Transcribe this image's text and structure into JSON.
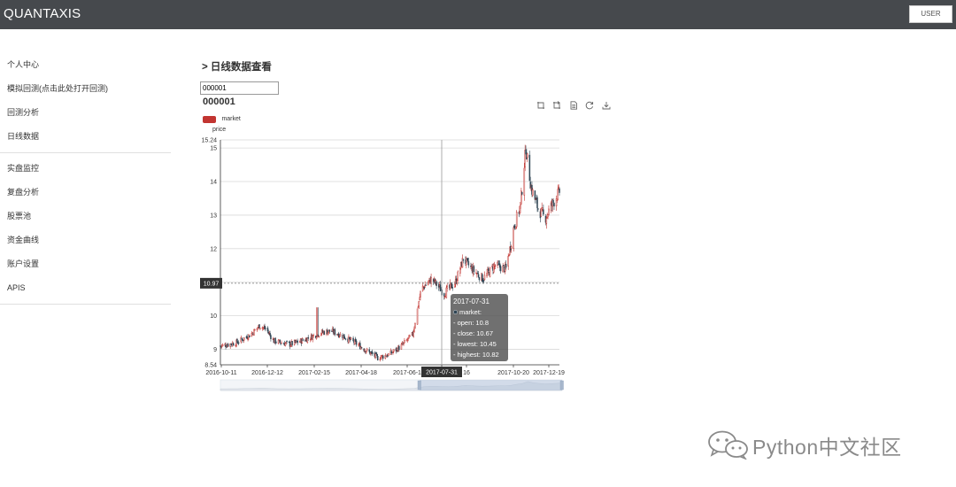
{
  "header": {
    "brand": "QUANTAXIS",
    "user_label": "USER"
  },
  "sidebar": {
    "group1": [
      {
        "label": "个人中心"
      },
      {
        "label": "模拟回测(点击此处打开回测)"
      },
      {
        "label": "回测分析"
      },
      {
        "label": "日线数据"
      }
    ],
    "group2": [
      {
        "label": "实盘监控"
      },
      {
        "label": "复盘分析"
      },
      {
        "label": "股票池"
      },
      {
        "label": "资金曲线"
      },
      {
        "label": "账户设置"
      },
      {
        "label": "APIS"
      }
    ]
  },
  "main": {
    "page_title": "> 日线数据查看",
    "code_input_value": "000001",
    "chart_title": "000001",
    "legend_label": "market",
    "y_axis_name": "price"
  },
  "colors": {
    "up": "#c23531",
    "down": "#2f4554",
    "topbar": "#46494d"
  },
  "toolbox": [
    "zoom-icon",
    "zoom-reset-icon",
    "data-view-icon",
    "restore-icon",
    "save-image-icon"
  ],
  "chart_data": {
    "type": "candlestick",
    "series": [
      {
        "name": "market"
      }
    ],
    "xlabel": "",
    "ylabel": "price",
    "ylim": [
      8.54,
      15.24
    ],
    "y_ticks": [
      8.54,
      9,
      10,
      11,
      12,
      13,
      14,
      15,
      15.24
    ],
    "x_ticks": [
      "2016-10-11",
      "2016-12-12",
      "2017-02-15",
      "2017-04-18",
      "2017-06-1",
      "2017-07-31",
      "16",
      "2017-10-20",
      "2017-12-19"
    ],
    "x_range": [
      "2016-10-11",
      "2017-12-29"
    ],
    "approx_close_path": [
      [
        "2016-10-11",
        9.1
      ],
      [
        "2016-11-01",
        9.2
      ],
      [
        "2016-11-20",
        9.45
      ],
      [
        "2016-12-01",
        9.7
      ],
      [
        "2016-12-10",
        9.6
      ],
      [
        "2016-12-20",
        9.25
      ],
      [
        "2017-01-10",
        9.15
      ],
      [
        "2017-01-25",
        9.25
      ],
      [
        "2017-02-10",
        9.4
      ],
      [
        "2017-02-20",
        9.5
      ],
      [
        "2017-03-05",
        9.55
      ],
      [
        "2017-03-20",
        9.4
      ],
      [
        "2017-04-05",
        9.2
      ],
      [
        "2017-04-18",
        9.0
      ],
      [
        "2017-05-05",
        8.75
      ],
      [
        "2017-05-20",
        8.85
      ],
      [
        "2017-06-05",
        9.1
      ],
      [
        "2017-06-20",
        9.45
      ],
      [
        "2017-07-01",
        10.8
      ],
      [
        "2017-07-15",
        11.1
      ],
      [
        "2017-07-31",
        10.67
      ],
      [
        "2017-08-15",
        11.0
      ],
      [
        "2017-08-25",
        11.7
      ],
      [
        "2017-09-05",
        11.4
      ],
      [
        "2017-09-20",
        11.1
      ],
      [
        "2017-10-05",
        11.5
      ],
      [
        "2017-10-20",
        11.4
      ],
      [
        "2017-10-30",
        12.6
      ],
      [
        "2017-11-08",
        13.3
      ],
      [
        "2017-11-15",
        15.0
      ],
      [
        "2017-11-22",
        13.8
      ],
      [
        "2017-12-01",
        13.2
      ],
      [
        "2017-12-10",
        12.9
      ],
      [
        "2017-12-19",
        13.3
      ],
      [
        "2017-12-29",
        13.7
      ]
    ],
    "spike": {
      "date": "2017-02-15",
      "high": 10.25
    },
    "crosshair": {
      "x_label": "2017-07-31",
      "y_label": "10.97",
      "y_value": 10.97
    },
    "tooltip": {
      "date": "2017-07-31",
      "series": "market:",
      "open": "- open: 10.8",
      "close": "- close: 10.67",
      "lowest": "- lowest: 10.45",
      "highest": "- highest: 10.82"
    }
  },
  "watermark": "Python中文社区"
}
